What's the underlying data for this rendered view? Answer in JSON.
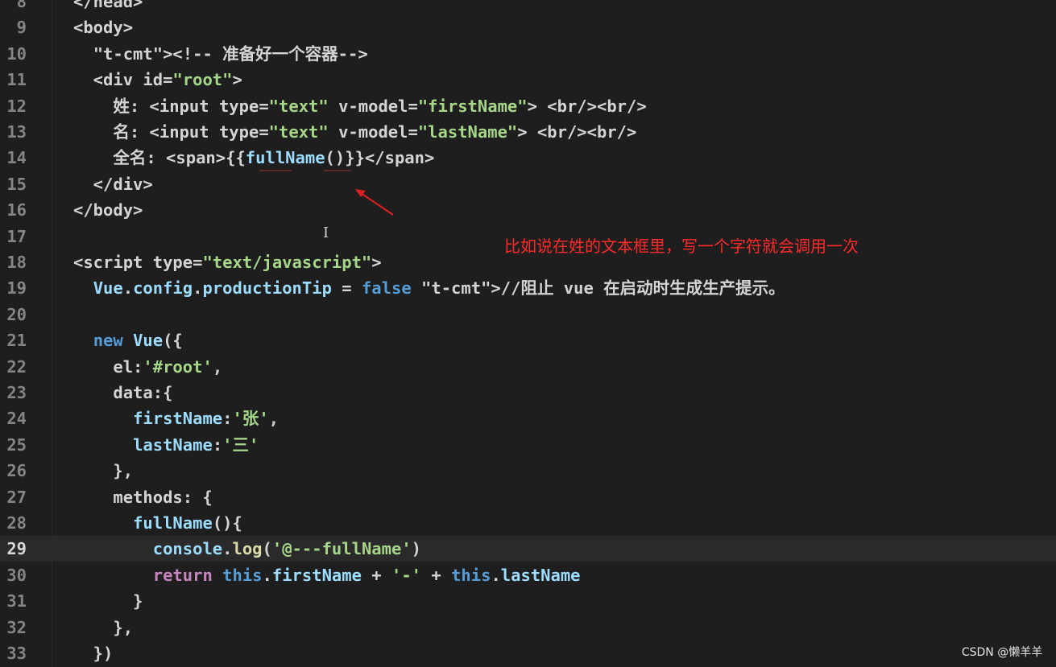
{
  "editor": {
    "lines": [
      {
        "n": "8",
        "text": "  </head>"
      },
      {
        "n": "9",
        "text": "  <body>"
      },
      {
        "n": "10",
        "text": "    <!-- 准备好一个容器-->"
      },
      {
        "n": "11",
        "text": "    <div id=\"root\">"
      },
      {
        "n": "12",
        "text": "      姓: <input type=\"text\" v-model=\"firstName\"> <br/><br/>"
      },
      {
        "n": "13",
        "text": "      名: <input type=\"text\" v-model=\"lastName\"> <br/><br/>"
      },
      {
        "n": "14",
        "text": "      全名: <span>{{fullName()}}</span>"
      },
      {
        "n": "15",
        "text": "    </div>"
      },
      {
        "n": "16",
        "text": "  </body>"
      },
      {
        "n": "17",
        "text": ""
      },
      {
        "n": "18",
        "text": "  <script type=\"text/javascript\">"
      },
      {
        "n": "19",
        "text": "    Vue.config.productionTip = false //阻止 vue 在启动时生成生产提示。"
      },
      {
        "n": "20",
        "text": ""
      },
      {
        "n": "21",
        "text": "    new Vue({"
      },
      {
        "n": "22",
        "text": "      el:'#root',"
      },
      {
        "n": "23",
        "text": "      data:{"
      },
      {
        "n": "24",
        "text": "        firstName:'张',"
      },
      {
        "n": "25",
        "text": "        lastName:'三'"
      },
      {
        "n": "26",
        "text": "      },"
      },
      {
        "n": "27",
        "text": "      methods: {"
      },
      {
        "n": "28",
        "text": "        fullName(){"
      },
      {
        "n": "29",
        "text": "          console.log('@---fullName')",
        "current": true
      },
      {
        "n": "30",
        "text": "          return this.firstName + '-' + this.lastName"
      },
      {
        "n": "31",
        "text": "        }"
      },
      {
        "n": "32",
        "text": "      },"
      },
      {
        "n": "33",
        "text": "    })"
      }
    ]
  },
  "annotation": {
    "text": "比如说在姓的文本框里，写一个字符就会调用一次",
    "color": "#ff2a2a"
  },
  "cursor_icon": "text-cursor-icon",
  "arrow_icon": "red-arrow-icon",
  "watermark": "CSDN @懒羊羊 "
}
